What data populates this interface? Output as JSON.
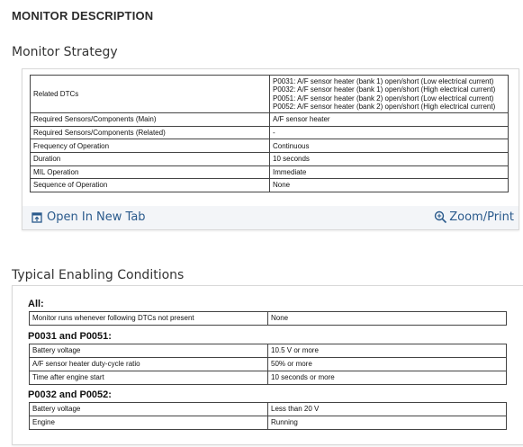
{
  "page": {
    "title": "MONITOR DESCRIPTION"
  },
  "strategy": {
    "heading": "Monitor Strategy",
    "rows": [
      {
        "key": "Related DTCs",
        "lines": [
          "P0031: A/F sensor heater (bank 1) open/short (Low electrical current)",
          "P0032: A/F sensor heater (bank 1) open/short (High electrical current)",
          "P0051: A/F sensor heater (bank 2) open/short (Low electrical current)",
          "P0052: A/F sensor heater (bank 2) open/short (High electrical current)"
        ]
      },
      {
        "key": "Required Sensors/Components (Main)",
        "value": "A/F sensor heater"
      },
      {
        "key": "Required Sensors/Components (Related)",
        "value": "-"
      },
      {
        "key": "Frequency of Operation",
        "value": "Continuous"
      },
      {
        "key": "Duration",
        "value": "10 seconds"
      },
      {
        "key": "MIL Operation",
        "value": "Immediate"
      },
      {
        "key": "Sequence of Operation",
        "value": "None"
      }
    ],
    "open_new_tab": "Open In New Tab",
    "zoom_print": "Zoom/Print"
  },
  "enabling": {
    "heading": "Typical Enabling Conditions",
    "groups": [
      {
        "title": "All:",
        "rows": [
          {
            "key": "Monitor runs whenever following DTCs not present",
            "value": "None"
          }
        ]
      },
      {
        "title": "P0031 and P0051:",
        "rows": [
          {
            "key": "Battery voltage",
            "value": "10.5 V or more"
          },
          {
            "key": "A/F sensor heater duty-cycle ratio",
            "value": "50% or more"
          },
          {
            "key": "Time after engine start",
            "value": "10 seconds or more"
          }
        ]
      },
      {
        "title": "P0032 and P0052:",
        "rows": [
          {
            "key": "Battery voltage",
            "value": "Less than 20 V"
          },
          {
            "key": "Engine",
            "value": "Running"
          }
        ]
      }
    ]
  },
  "colors": {
    "link": "#2a5a8c",
    "footer_bg": "#f3f5f8"
  },
  "icons": {
    "open_tab": "open-new-tab-icon",
    "zoom": "zoom-magnifier-icon"
  }
}
